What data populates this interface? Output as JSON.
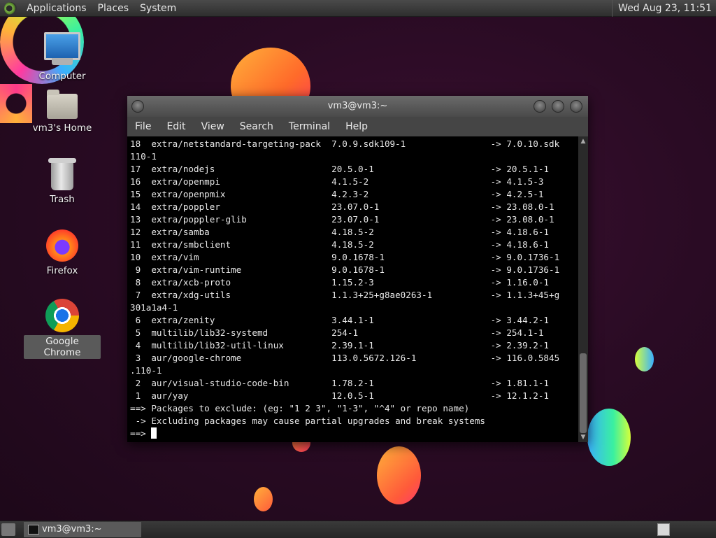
{
  "top_panel": {
    "menus": [
      "Applications",
      "Places",
      "System"
    ],
    "clock": "Wed Aug 23, 11:51"
  },
  "desktop_icons": [
    {
      "label": "Computer",
      "icon": "computer-icon"
    },
    {
      "label": "vm3's Home",
      "icon": "home-folder-icon"
    },
    {
      "label": "Trash",
      "icon": "trash-icon"
    },
    {
      "label": "Firefox",
      "icon": "firefox-icon"
    },
    {
      "label": "Google Chrome",
      "icon": "chrome-icon"
    }
  ],
  "terminal": {
    "title": "vm3@vm3:~",
    "menu": [
      "File",
      "Edit",
      "View",
      "Search",
      "Terminal",
      "Help"
    ],
    "lines": [
      "18  extra/netstandard-targeting-pack  7.0.9.sdk109-1                -> 7.0.10.sdk",
      "110-1",
      "17  extra/nodejs                      20.5.0-1                      -> 20.5.1-1",
      "16  extra/openmpi                     4.1.5-2                       -> 4.1.5-3",
      "15  extra/openpmix                    4.2.3-2                       -> 4.2.5-1",
      "14  extra/poppler                     23.07.0-1                     -> 23.08.0-1",
      "13  extra/poppler-glib                23.07.0-1                     -> 23.08.0-1",
      "12  extra/samba                       4.18.5-2                      -> 4.18.6-1",
      "11  extra/smbclient                   4.18.5-2                      -> 4.18.6-1",
      "10  extra/vim                         9.0.1678-1                    -> 9.0.1736-1",
      " 9  extra/vim-runtime                 9.0.1678-1                    -> 9.0.1736-1",
      " 8  extra/xcb-proto                   1.15.2-3                      -> 1.16.0-1",
      " 7  extra/xdg-utils                   1.1.3+25+g8ae0263-1           -> 1.1.3+45+g",
      "301a1a4-1",
      " 6  extra/zenity                      3.44.1-1                      -> 3.44.2-1",
      " 5  multilib/lib32-systemd            254-1                         -> 254.1-1",
      " 4  multilib/lib32-util-linux         2.39.1-1                      -> 2.39.2-1",
      " 3  aur/google-chrome                 113.0.5672.126-1              -> 116.0.5845",
      ".110-1",
      " 2  aur/visual-studio-code-bin        1.78.2-1                      -> 1.81.1-1",
      " 1  aur/yay                           12.0.5-1                      -> 12.1.2-1",
      "==> Packages to exclude: (eg: \"1 2 3\", \"1-3\", \"^4\" or repo name)",
      " -> Excluding packages may cause partial upgrades and break systems"
    ],
    "prompt": "==> "
  },
  "taskbar": {
    "tasks": [
      "vm3@vm3:~"
    ]
  }
}
